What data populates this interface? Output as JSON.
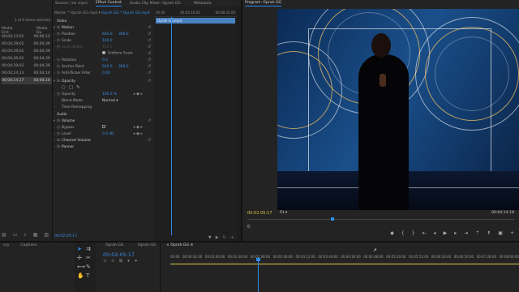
{
  "tabs": {
    "source": "Source: (no clips)",
    "effect_controls": "Effect Controls",
    "audio_mixer": "Audio Clip Mixer: Oprah GG",
    "metadata": "Metadata",
    "program": "Program: Oprah GG"
  },
  "project": {
    "count": "1 of 6 items selected",
    "col_media_end": "Media End",
    "col_media_du": "Media Du",
    "rows": [
      {
        "end": "00;00;13;01",
        "du": "00;00;13"
      },
      {
        "end": "00;04;39;02",
        "du": "00;04;39"
      },
      {
        "end": "00;04;39;02",
        "du": "00;04;39"
      },
      {
        "end": "00;04;39;02",
        "du": "00;04;39"
      },
      {
        "end": "00;04;39;02",
        "du": "00;04;39"
      },
      {
        "end": "00;04;14;13",
        "du": "00;04;14"
      },
      {
        "end": "00;04;14;17",
        "du": "00;04;14"
      }
    ],
    "bottom_icons": [
      "list-icon",
      "folder-icon",
      "search-icon",
      "new-item-icon",
      "trash-icon"
    ]
  },
  "effects": {
    "master": "Master * Oprah GG.mp4",
    "clip": "Oprah GG * Oprah GG.mp4",
    "video_label": "Video",
    "motion": "Motion",
    "position_label": "Position",
    "position_x": "640.0",
    "position_y": "360.0",
    "scale_label": "Scale",
    "scale_value": "100.0",
    "scale_width_label": "Scale Width",
    "scale_width_value": "100.0",
    "uniform_scale": "Uniform Scale",
    "rotation_label": "Rotation",
    "rotation_value": "0.0",
    "anchor_label": "Anchor Point",
    "anchor_x": "640.0",
    "anchor_y": "360.0",
    "antiflicker_label": "Anti-flicker Filter",
    "antiflicker_value": "0.00",
    "opacity_section": "Opacity",
    "opacity_label": "Opacity",
    "opacity_value": "100.0 %",
    "blend_label": "Blend Mode",
    "blend_value": "Normal",
    "time_remap": "Time Remapping",
    "audio_label": "Audio",
    "volume": "Volume",
    "bypass": "Bypass",
    "level_label": "Level",
    "level_value": "0.0 dB",
    "channel_volume": "Channel Volume",
    "panner": "Panner",
    "timecode": "00:02:05:17"
  },
  "minitl": {
    "start": "00:00",
    "mid": "00:04:16:00",
    "end": "00:08:32:00",
    "clip": "Oprah GG.mp4"
  },
  "program": {
    "timecode": "00:02:05:17",
    "fit": "Fit",
    "duration": "00:04:14:18",
    "controls": [
      "marker-icon",
      "in-icon",
      "out-icon",
      "goto-in-icon",
      "step-back-icon",
      "play-icon",
      "step-forward-icon",
      "goto-out-icon",
      "lift-icon",
      "extract-icon",
      "export-frame-icon",
      "button-editor-icon"
    ]
  },
  "bottom": {
    "tab_history": "ory",
    "tab_captions": "Captions",
    "src_label_a": "Oprah GG",
    "src_label_b": "Oprah GG",
    "src_timecode": "00:02:05:17",
    "timeline_title": "Oprah GG",
    "ruler": [
      "00:00",
      "00:00:32:00",
      "00:01:04:00",
      "00:01:36:00",
      "00:02:08:00",
      "00:02:40:00",
      "00:03:12:00",
      "00:03:44:00",
      "00:04:16:00",
      "00:04:48:00",
      "00:05:20:00",
      "00:05:52:00",
      "00:06:24:00",
      "00:06:56:00",
      "00:07:28:00",
      "00:08:00:00"
    ]
  },
  "colors": {
    "accent": "#2d8ceb",
    "timecode_yellow": "#e0c44a",
    "timeline_track": "#d6c64a"
  }
}
